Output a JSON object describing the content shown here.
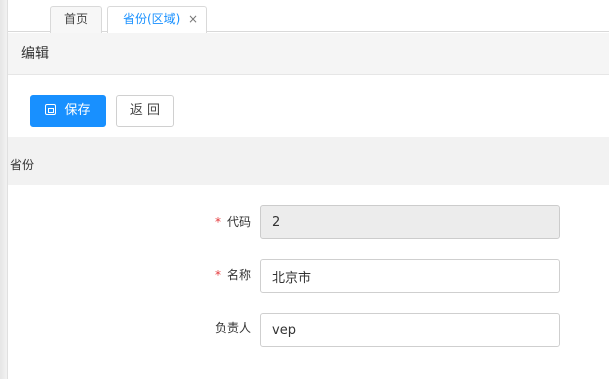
{
  "tabs": [
    {
      "label": "首页"
    },
    {
      "label": "省份(区域)",
      "active": true,
      "close": "×"
    }
  ],
  "header": {
    "title": "编辑"
  },
  "toolbar": {
    "save_label": "保存",
    "back_label": "返 回"
  },
  "section": {
    "title": "省份"
  },
  "form": {
    "code": {
      "label": "代码",
      "required_mark": "*",
      "value": "2",
      "disabled": true
    },
    "name": {
      "label": "名称",
      "required_mark": "*",
      "value": "北京市"
    },
    "owner": {
      "label": "负责人",
      "value": "vep"
    }
  },
  "colors": {
    "accent": "#1890ff",
    "required": "#e4393c"
  }
}
